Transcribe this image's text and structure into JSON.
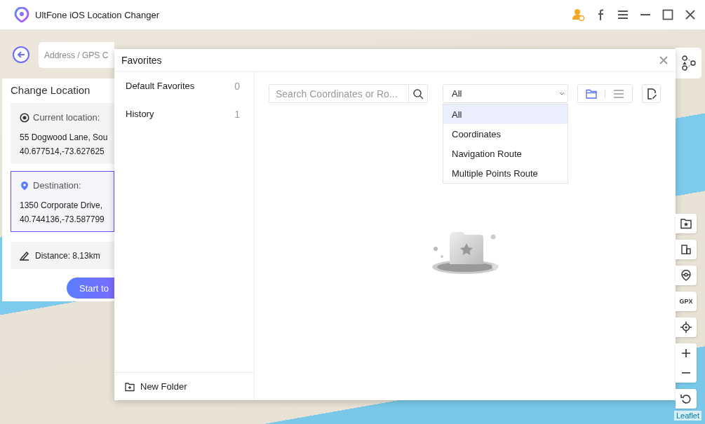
{
  "window": {
    "title": "UltFone iOS Location Changer"
  },
  "search_bar": {
    "placeholder": "Address / GPS C"
  },
  "change_location": {
    "title": "Change Location",
    "cards": [
      {
        "kind": "current",
        "label": "Current location:",
        "address": "55 Dogwood Lane, Sou",
        "coordinates": "40.677514,-73.627625",
        "selected": false
      },
      {
        "kind": "destination",
        "label": "Destination:",
        "address": "1350 Corporate Drive,",
        "coordinates": "40.744136,-73.587799",
        "selected": true
      }
    ],
    "distance": "Distance: 8.13km",
    "start_button": "Start to"
  },
  "favorites": {
    "title": "Favorites",
    "folders": [
      {
        "name": "Default Favorites",
        "count": "0"
      },
      {
        "name": "History",
        "count": "1"
      }
    ],
    "new_folder": "New Folder",
    "search": {
      "placeholder": "Search Coordinates or Ro..."
    },
    "filter": {
      "value": "All",
      "expanded": true,
      "options": [
        {
          "label": "All",
          "selected": true
        },
        {
          "label": "Coordinates",
          "selected": false
        },
        {
          "label": "Navigation Route",
          "selected": false
        },
        {
          "label": "Multiple Points Route",
          "selected": false
        }
      ]
    },
    "view_modes": [
      {
        "kind": "folder",
        "selected": true
      },
      {
        "kind": "list",
        "selected": false
      }
    ]
  },
  "map_tools": [
    {
      "kind": "favorites"
    },
    {
      "kind": "device"
    },
    {
      "kind": "pin"
    },
    {
      "kind": "gpx",
      "label": "GPX"
    },
    {
      "kind": "locate"
    },
    {
      "kind": "zoom"
    },
    {
      "kind": "reset"
    }
  ],
  "attribution": "Leaflet"
}
